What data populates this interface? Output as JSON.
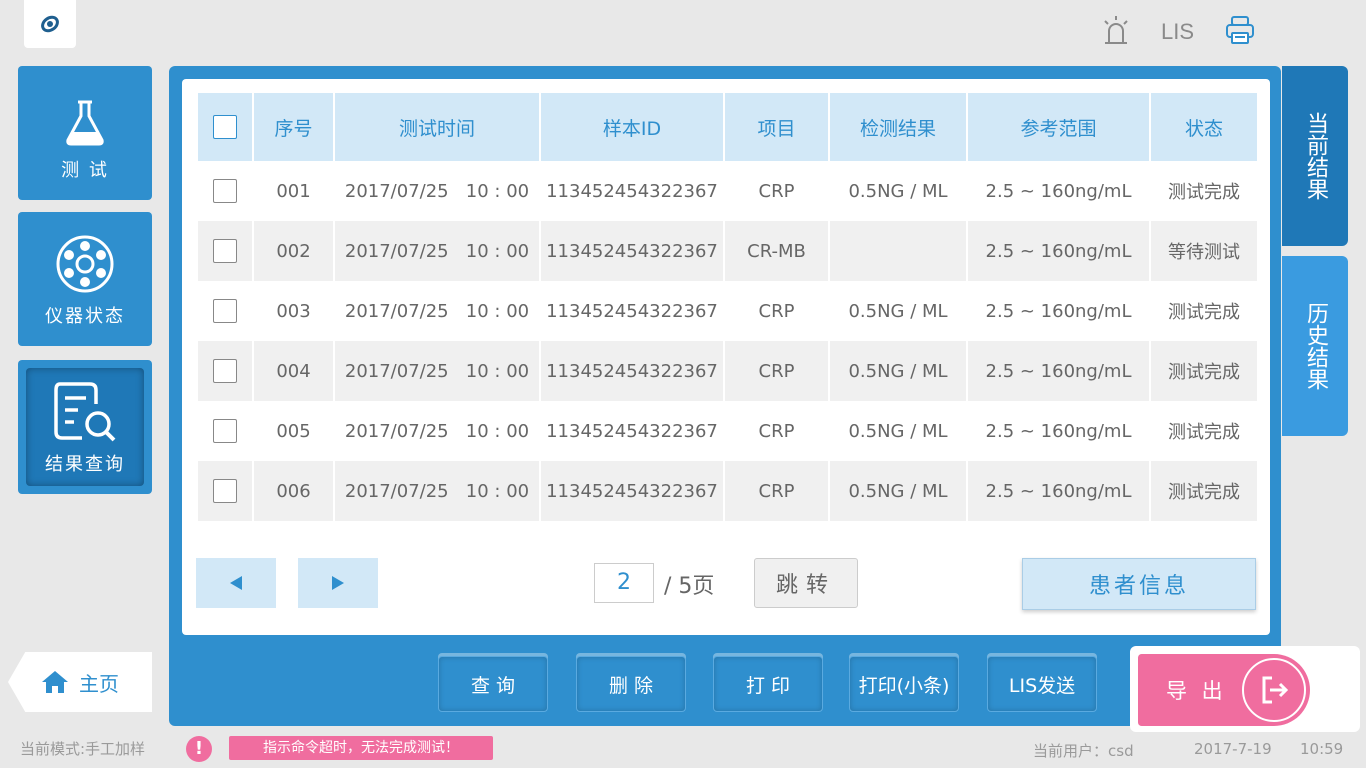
{
  "top_bar": {
    "lis_label": "LIS"
  },
  "nav": {
    "test": "测 试",
    "instrument_status": "仪器状态",
    "result_query": "结果查询",
    "home": "主页"
  },
  "side_tabs": {
    "current": "当前结果",
    "history": "历史结果"
  },
  "table": {
    "headers": [
      "序号",
      "测试时间",
      "样本ID",
      "项目",
      "检测结果",
      "参考范围",
      "状态"
    ],
    "rows": [
      {
        "no": "001",
        "time": "2017/07/25   10 : 00",
        "sample_id": "113452454322367",
        "item": "CRP",
        "result": "0.5NG / ML",
        "range": "2.5 ~ 160ng/mL",
        "status": "测试完成"
      },
      {
        "no": "002",
        "time": "2017/07/25   10 : 00",
        "sample_id": "113452454322367",
        "item": "CR-MB",
        "result": "",
        "range": "2.5 ~ 160ng/mL",
        "status": "等待测试"
      },
      {
        "no": "003",
        "time": "2017/07/25   10 : 00",
        "sample_id": "113452454322367",
        "item": "CRP",
        "result": "0.5NG / ML",
        "range": "2.5 ~ 160ng/mL",
        "status": "测试完成"
      },
      {
        "no": "004",
        "time": "2017/07/25   10 : 00",
        "sample_id": "113452454322367",
        "item": "CRP",
        "result": "0.5NG / ML",
        "range": "2.5 ~ 160ng/mL",
        "status": "测试完成"
      },
      {
        "no": "005",
        "time": "2017/07/25   10 : 00",
        "sample_id": "113452454322367",
        "item": "CRP",
        "result": "0.5NG / ML",
        "range": "2.5 ~ 160ng/mL",
        "status": "测试完成"
      },
      {
        "no": "006",
        "time": "2017/07/25   10 : 00",
        "sample_id": "113452454322367",
        "item": "CRP",
        "result": "0.5NG / ML",
        "range": "2.5 ~ 160ng/mL",
        "status": "测试完成"
      }
    ]
  },
  "pager": {
    "current_page": "2",
    "total": "/ 5页",
    "jump": "跳转",
    "patient_info": "患者信息"
  },
  "actions": {
    "query": "查 询",
    "delete": "删 除",
    "print": "打 印",
    "print_slip": "打印(小条)",
    "lis_send": "LIS发送",
    "export": "导 出"
  },
  "status_bar": {
    "mode": "当前模式:手工加样",
    "warning_icon": "!",
    "warning": "指示命令超时，无法完成测试！",
    "user": "当前用户：csd",
    "date": "2017-7-19",
    "time": "10:59"
  },
  "colors": {
    "primary": "#2f8fce",
    "active": "#1f78b7",
    "header_bg": "#d2e8f7",
    "accent_pink": "#f06d9f"
  }
}
